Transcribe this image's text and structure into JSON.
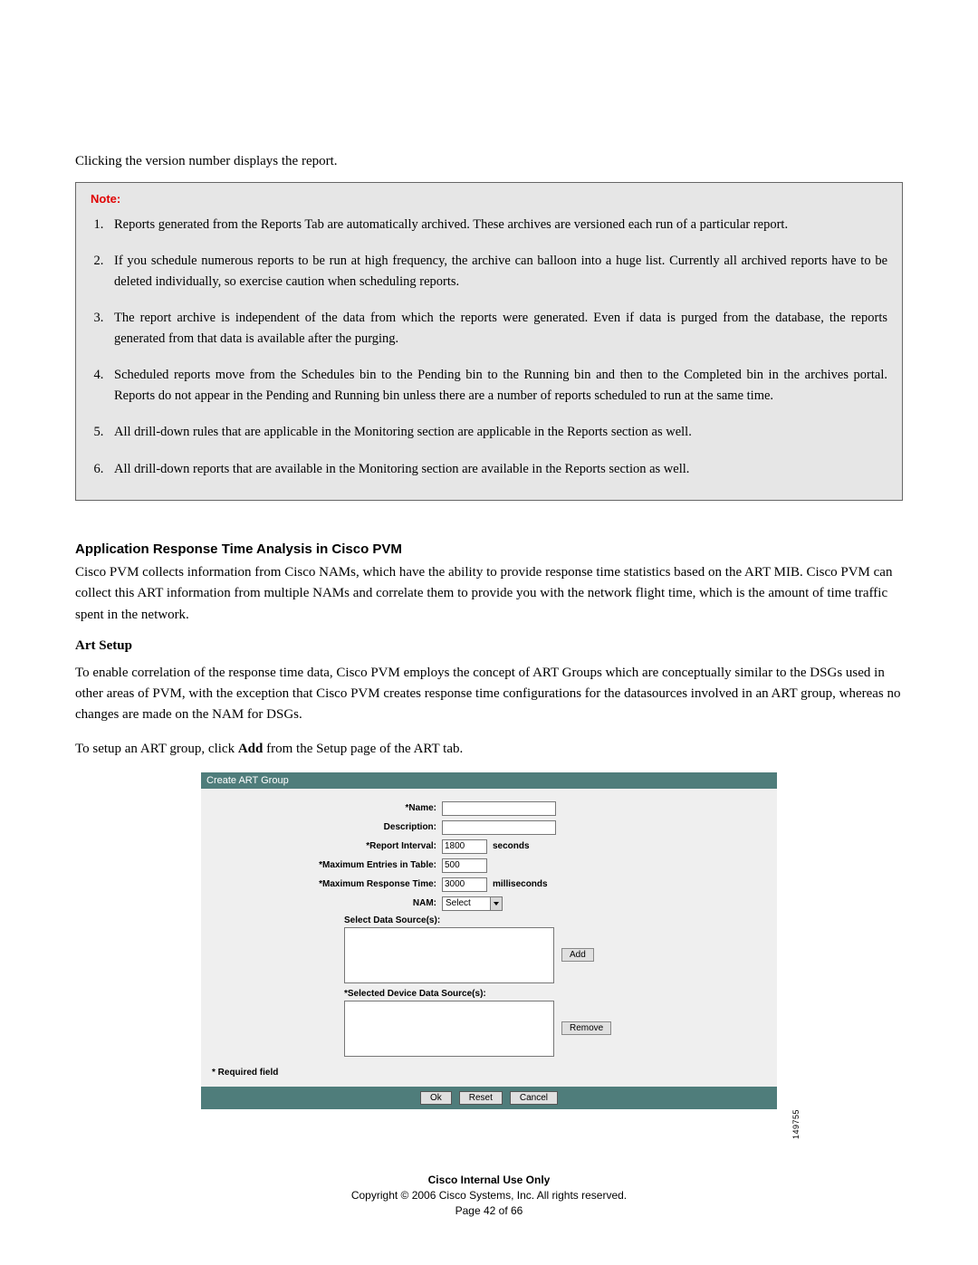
{
  "intro": "Clicking the version number displays the report.",
  "note": {
    "title": "Note:",
    "items": [
      "Reports generated from the Reports Tab are automatically archived. These archives are versioned each run of a particular report.",
      "If you schedule numerous reports to be run at high frequency, the archive can balloon into a huge list. Currently all archived reports have to be deleted individually, so exercise caution when scheduling reports.",
      "The report archive is independent of the data from which the reports were generated. Even if data is purged from the database, the reports generated from that data is available after the purging.",
      "Scheduled reports move from the Schedules bin to the Pending bin to the Running bin and then to the Completed bin in the archives portal. Reports do not appear in the Pending and Running bin unless there are a number of reports scheduled to run at the same time.",
      "All drill-down rules that are applicable in the Monitoring section are applicable in the Reports section as well.",
      "All drill-down reports that are available in the Monitoring section are available in the Reports section as well."
    ]
  },
  "sections": {
    "art_title": "Application Response Time Analysis in Cisco PVM",
    "art_body": "Cisco PVM collects information from Cisco NAMs, which have the ability to provide response time statistics based on the ART MIB. Cisco PVM can collect this ART information from multiple NAMs and correlate them to provide you with the network flight time, which is the amount of time traffic spent in the network.",
    "setup_title": "Art Setup",
    "setup_body": "To enable correlation of the response time data, Cisco PVM employs the concept of ART Groups which are conceptually similar to the DSGs used in other areas of PVM, with the exception that Cisco PVM creates response time configurations for the datasources involved in an ART group, whereas no changes are made on the NAM for DSGs.",
    "setup_body2_pre": "To setup an ART group, click ",
    "setup_body2_bold": "Add",
    "setup_body2_post": " from the Setup page of the ART tab."
  },
  "embed": {
    "header": "Create ART Group",
    "labels": {
      "name": "*Name:",
      "description": "Description:",
      "report_interval": "*Report Interval:",
      "max_entries": "*Maximum Entries in Table:",
      "max_response": "*Maximum Response Time:",
      "nam": "NAM:",
      "select_ds": "Select Data Source(s):",
      "selected_ds": "*Selected Device Data Source(s):",
      "required": "* Required field"
    },
    "values": {
      "name": "",
      "description": "",
      "report_interval": "1800",
      "max_entries": "500",
      "max_response": "3000",
      "nam_selected": "Select"
    },
    "units": {
      "seconds": "seconds",
      "milliseconds": "milliseconds"
    },
    "buttons": {
      "add": "Add",
      "remove": "Remove",
      "ok": "Ok",
      "reset": "Reset",
      "cancel": "Cancel"
    },
    "figure_id": "149755"
  },
  "footer": {
    "line1": "Cisco Internal Use Only",
    "line2": "Copyright © 2006 Cisco Systems, Inc. All rights reserved.",
    "line3": "Page 42 of 66"
  }
}
